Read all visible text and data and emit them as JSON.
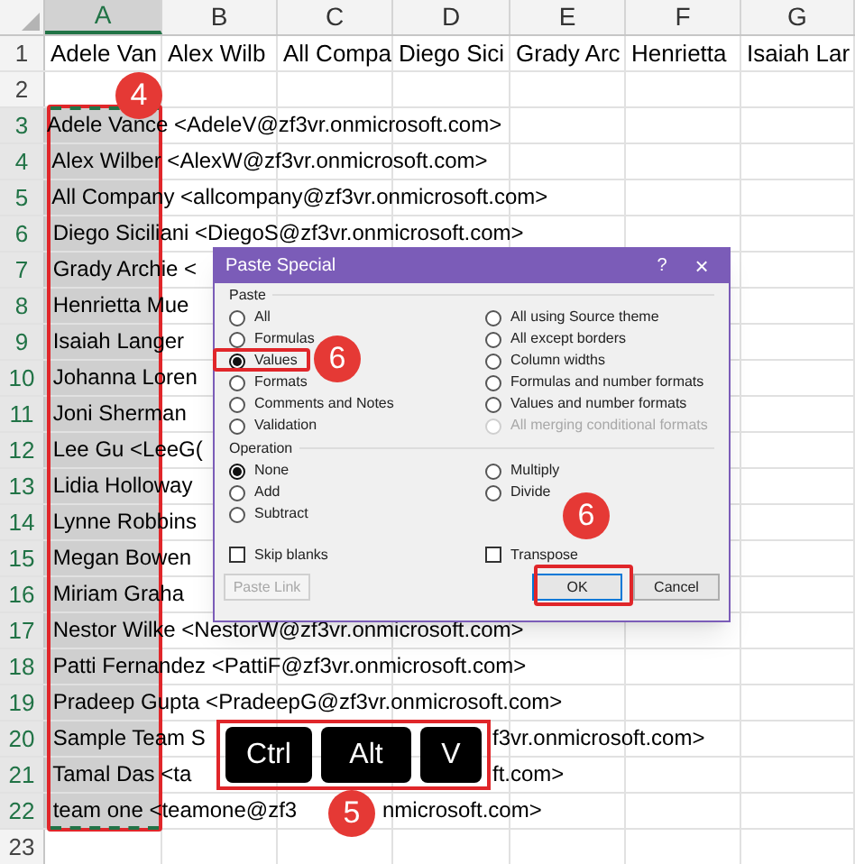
{
  "columns": [
    {
      "label": "A",
      "selected": true
    },
    {
      "label": "B",
      "selected": false
    },
    {
      "label": "C",
      "selected": false
    },
    {
      "label": "D",
      "selected": false
    },
    {
      "label": "E",
      "selected": false
    },
    {
      "label": "F",
      "selected": false
    },
    {
      "label": "G",
      "selected": false
    }
  ],
  "rows": [
    {
      "number": "1",
      "selected": false,
      "cells": [
        "Adele Van",
        "Alex Wilb",
        "All Compa",
        "Diego Sici",
        "Grady Arc",
        "Henrietta",
        "Isaiah Lar"
      ]
    },
    {
      "number": "2",
      "selected": false
    },
    {
      "number": "3",
      "selected": true,
      "text": "Adele Vance <AdeleV@zf3vr.onmicrosoft.com>"
    },
    {
      "number": "4",
      "selected": true,
      "text": " Alex Wilber <AlexW@zf3vr.onmicrosoft.com>"
    },
    {
      "number": "5",
      "selected": true,
      "text": " All Company <allcompany@zf3vr.onmicrosoft.com>"
    },
    {
      "number": "6",
      "selected": true,
      "text": " Diego Siciliani <DiegoS@zf3vr.onmicrosoft.com>"
    },
    {
      "number": "7",
      "selected": true,
      "text": " Grady Archie <"
    },
    {
      "number": "8",
      "selected": true,
      "text": " Henrietta Mue"
    },
    {
      "number": "9",
      "selected": true,
      "text": " Isaiah Langer"
    },
    {
      "number": "10",
      "selected": true,
      "text": " Johanna Loren"
    },
    {
      "number": "11",
      "selected": true,
      "text": " Joni Sherman"
    },
    {
      "number": "12",
      "selected": true,
      "text": " Lee Gu <LeeG("
    },
    {
      "number": "13",
      "selected": true,
      "text": " Lidia Holloway"
    },
    {
      "number": "14",
      "selected": true,
      "text": " Lynne Robbins"
    },
    {
      "number": "15",
      "selected": true,
      "text": " Megan Bowen"
    },
    {
      "number": "16",
      "selected": true,
      "text": " Miriam Graha"
    },
    {
      "number": "17",
      "selected": true,
      "text": " Nestor Wilke <NestorW@zf3vr.onmicrosoft.com>"
    },
    {
      "number": "18",
      "selected": true,
      "text": " Patti Fernandez <PattiF@zf3vr.onmicrosoft.com>"
    },
    {
      "number": "19",
      "selected": true,
      "text": " Pradeep Gupta <PradeepG@zf3vr.onmicrosoft.com>"
    },
    {
      "number": "20",
      "selected": true,
      "text": " Sample Team S",
      "text_after": "f3vr.onmicrosoft.com>"
    },
    {
      "number": "21",
      "selected": true,
      "text": " Tamal Das <ta",
      "text_after": "ft.com>"
    },
    {
      "number": "22",
      "selected": true,
      "text": " team one <teamone@zf3",
      "text_after": "nmicrosoft.com>"
    },
    {
      "number": "23",
      "selected": false
    }
  ],
  "dialog": {
    "title": "Paste Special",
    "help": "?",
    "close": "×",
    "paste": {
      "label": "Paste",
      "left": [
        {
          "label": "All",
          "selected": false,
          "disabled": false
        },
        {
          "label": "Formulas",
          "selected": false,
          "disabled": false
        },
        {
          "label": "Values",
          "selected": true,
          "disabled": false
        },
        {
          "label": "Formats",
          "selected": false,
          "disabled": false
        },
        {
          "label": "Comments and Notes",
          "selected": false,
          "disabled": false
        },
        {
          "label": "Validation",
          "selected": false,
          "disabled": false
        }
      ],
      "right": [
        {
          "label": "All using Source theme",
          "selected": false,
          "disabled": false
        },
        {
          "label": "All except borders",
          "selected": false,
          "disabled": false
        },
        {
          "label": "Column widths",
          "selected": false,
          "disabled": false
        },
        {
          "label": "Formulas and number formats",
          "selected": false,
          "disabled": false
        },
        {
          "label": "Values and number formats",
          "selected": false,
          "disabled": false
        },
        {
          "label": "All merging conditional formats",
          "selected": false,
          "disabled": true
        }
      ]
    },
    "operation": {
      "label": "Operation",
      "left": [
        {
          "label": "None",
          "selected": true,
          "disabled": false
        },
        {
          "label": "Add",
          "selected": false,
          "disabled": false
        },
        {
          "label": "Subtract",
          "selected": false,
          "disabled": false
        }
      ],
      "right": [
        {
          "label": "Multiply",
          "selected": false,
          "disabled": false
        },
        {
          "label": "Divide",
          "selected": false,
          "disabled": false
        }
      ]
    },
    "checkboxes": [
      {
        "label": "Skip blanks",
        "checked": false
      },
      {
        "label": "Transpose",
        "checked": false
      }
    ],
    "buttons": [
      {
        "label": "Paste Link",
        "disabled": true,
        "default": false
      },
      {
        "label": "OK",
        "disabled": false,
        "default": true
      },
      {
        "label": "Cancel",
        "disabled": false,
        "default": false
      }
    ]
  },
  "annotations": {
    "badges": [
      "4",
      "6",
      "6",
      "5"
    ],
    "keys": [
      "Ctrl",
      "Alt",
      "V"
    ]
  }
}
